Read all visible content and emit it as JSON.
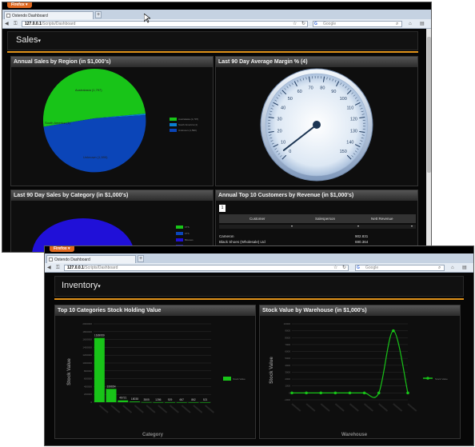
{
  "window1": {
    "firefox_button": "Firefox ▾",
    "tab_title": "Ostendo Dashboard",
    "new_tab": "+",
    "url_host": "127.0.0.1",
    "url_path": "/Scripts/Dashboard",
    "search_placeholder": "Google",
    "dashboard_title": "Sales",
    "panels": {
      "sales_region": {
        "title": "Annual Sales by Region (in $1,000's)",
        "slice_labels": [
          "Australasia (1,797)",
          "South America (1)",
          "Unknown (1,590)"
        ],
        "legend": [
          "Australasia (1,797)",
          "South America (1)",
          "Unknown (1,590)"
        ]
      },
      "margin": {
        "title": "Last 90 Day Average Margin % (4)"
      },
      "category": {
        "title": "Last 90 Day Sales by Category (in $1,000's)",
        "legend": [
          "FTS",
          "FTS",
          "Blouses",
          "Embroidery"
        ]
      },
      "customers": {
        "title": "Annual Top 10 Customers by Revenue (in $1,000's)",
        "page": "1",
        "columns": [
          "Customer",
          "Salesperson",
          "Nett Revenue"
        ],
        "rows": [
          {
            "customer": "Cameron",
            "salesperson": "",
            "revenue": "902.831"
          },
          {
            "customer": "Black Shoes (Wholesale) Ltd",
            "salesperson": "",
            "revenue": "690.364"
          }
        ]
      }
    }
  },
  "window2": {
    "firefox_button": "Firefox ▾",
    "tab_title": "Ostendo Dashboard",
    "new_tab": "+",
    "url_host": "127.0.0.1",
    "url_path": "/Scripts/Dashboard",
    "search_placeholder": "Google",
    "dashboard_title": "Inventory",
    "panels": {
      "stock_category": {
        "title": "Top 10 Categories Stock Holding Value",
        "xlabel": "Category",
        "ylabel": "Stock Value",
        "legend": "Stock Value"
      },
      "warehouse": {
        "title": "Stock Value by Warehouse (in $1,000's)",
        "xlabel": "Warehouse",
        "ylabel": "Stock Value",
        "legend": "Stock Value"
      }
    }
  },
  "colors": {
    "accent": "#e2931a",
    "green": "#18c418",
    "blue": "#0b45b8",
    "category_blue": "#2010d8"
  },
  "chart_data": [
    {
      "type": "pie",
      "title": "Annual Sales by Region (in $1,000's)",
      "categories": [
        "Australasia",
        "South America",
        "Unknown"
      ],
      "values": [
        1797,
        1,
        1590
      ],
      "colors": [
        "#18c418",
        "#0b7fd0",
        "#0b45b8"
      ],
      "legend": "right"
    },
    {
      "type": "gauge",
      "title": "Last 90 Day Average Margin % (4)",
      "value": 4,
      "range": [
        0,
        150
      ],
      "major_ticks": [
        0,
        10,
        20,
        30,
        40,
        50,
        60,
        70,
        80,
        90,
        100,
        110,
        120,
        130,
        140,
        150
      ]
    },
    {
      "type": "pie",
      "title": "Last 90 Day Sales by Category (in $1,000's)",
      "categories": [
        "FTS",
        "FTS",
        "Blouses",
        "Embroidery"
      ],
      "legend": "right"
    },
    {
      "type": "bar",
      "title": "Top 10 Categories Stock Holding Value",
      "xlabel": "Category",
      "ylabel": "Stock Value",
      "ylim": [
        0,
        2000000
      ],
      "yticks": [
        0,
        200000,
        400000,
        600000,
        800000,
        1000000,
        1200000,
        1400000,
        1600000,
        1800000,
        2000000
      ],
      "data_labels": [
        "1639959",
        "339654",
        "46721",
        "18038",
        "3505",
        "1286",
        "929",
        "667",
        "862",
        "521"
      ],
      "values": [
        1639959,
        339654,
        46721,
        18038,
        3505,
        1286,
        929,
        667,
        862,
        521
      ],
      "legend": "right",
      "grid": true
    },
    {
      "type": "line",
      "title": "Stock Value by Warehouse (in $1,000's)",
      "xlabel": "Warehouse",
      "ylabel": "Stock Value",
      "ylim": [
        -1000,
        10000
      ],
      "yticks": [
        -1000,
        0,
        1000,
        2000,
        3000,
        4000,
        5000,
        6000,
        7000,
        8000,
        9000,
        10000
      ],
      "values": [
        0,
        0,
        0,
        0,
        0,
        0,
        0,
        9000,
        0
      ],
      "legend": "right",
      "grid": true
    }
  ]
}
